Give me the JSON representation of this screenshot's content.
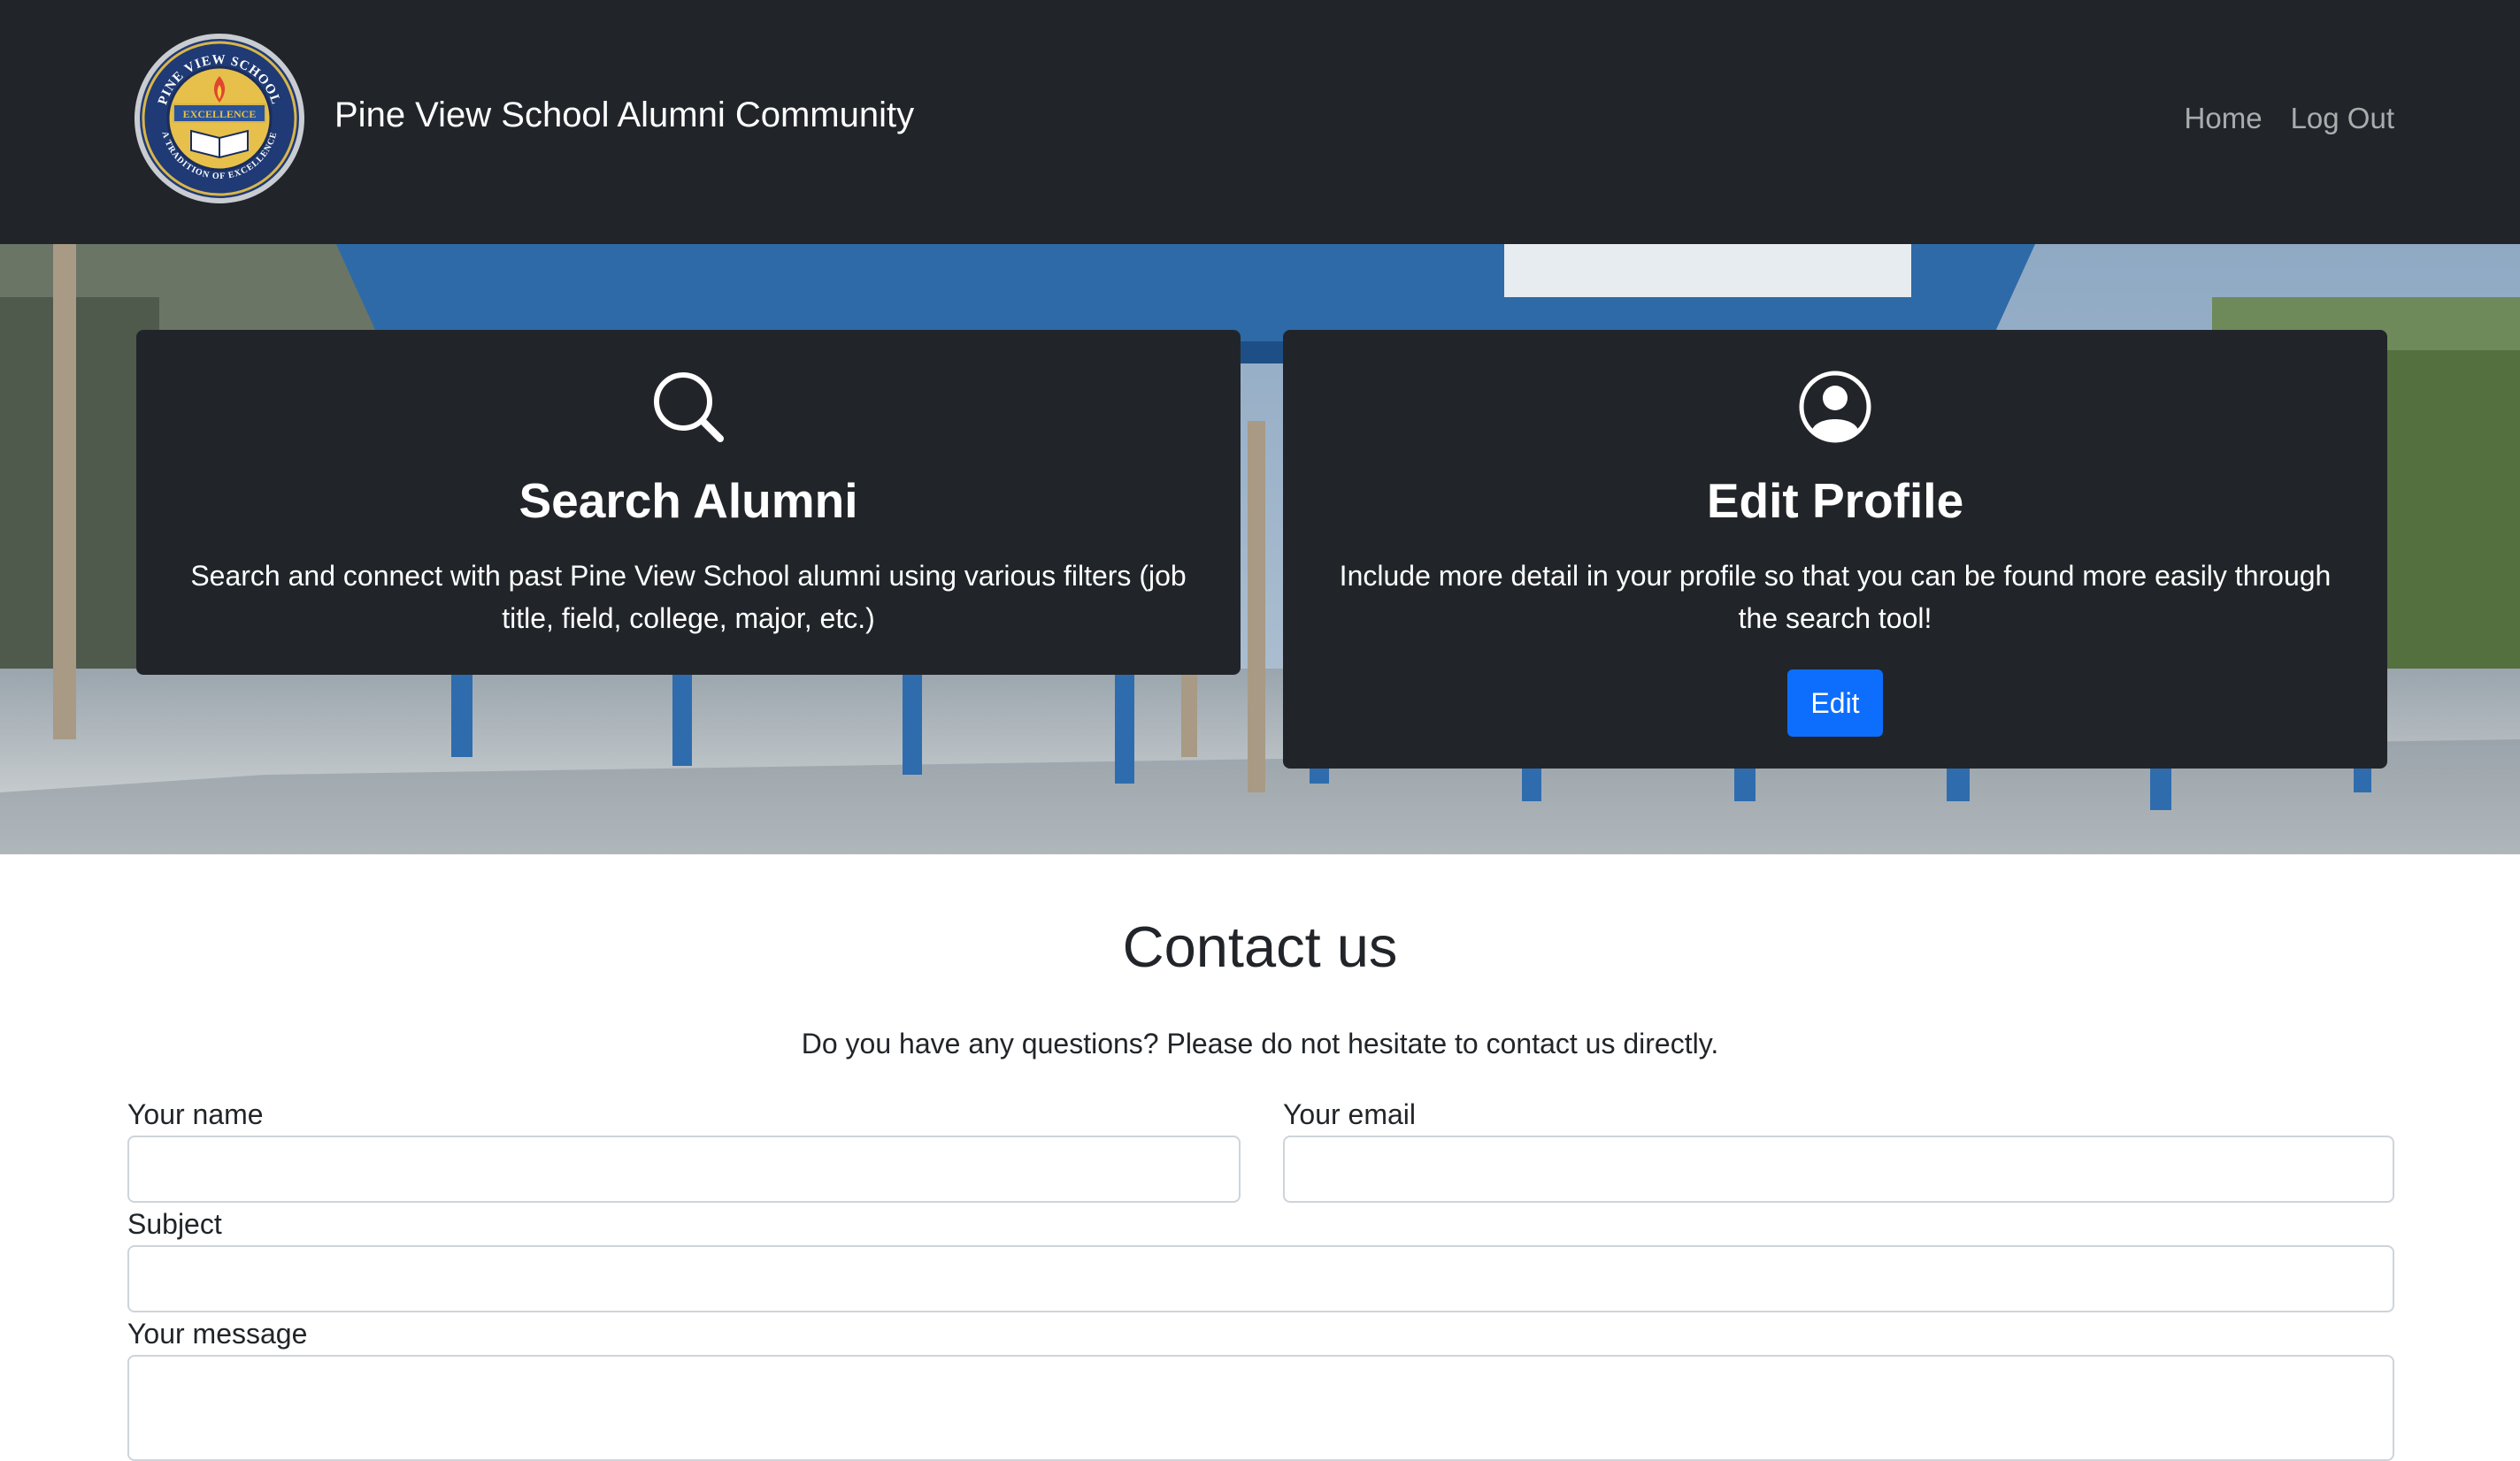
{
  "header": {
    "brand_title": "Pine View School Alumni Community",
    "logo": {
      "icon": "school-seal",
      "ring_top_text": "PINE VIEW SCHOOL",
      "banner_text": "EXCELLENCE",
      "ring_bottom_text": "A TRADITION OF EXCELLENCE"
    },
    "nav": [
      {
        "label": "Home"
      },
      {
        "label": "Log Out"
      }
    ]
  },
  "cards": {
    "search": {
      "icon": "search-icon",
      "title": "Search Alumni",
      "text": "Search and connect with past Pine View School alumni using various filters (job title, field, college, major, etc.)"
    },
    "edit": {
      "icon": "user-circle-icon",
      "title": "Edit Profile",
      "text": "Include more detail in your profile so that you can be found more easily through the search tool!",
      "button_label": "Edit"
    }
  },
  "contact": {
    "title": "Contact us",
    "lead": "Do you have any questions? Please do not hesitate to contact us directly.",
    "fields": {
      "name": {
        "label": "Your name",
        "value": ""
      },
      "email": {
        "label": "Your email",
        "value": ""
      },
      "subject": {
        "label": "Subject",
        "value": ""
      },
      "message": {
        "label": "Your message",
        "value": ""
      }
    }
  },
  "colors": {
    "navbar_bg": "#212529",
    "card_bg": "#212529",
    "primary_button": "#0d6efd",
    "nav_link": "rgba(255,255,255,0.62)"
  }
}
